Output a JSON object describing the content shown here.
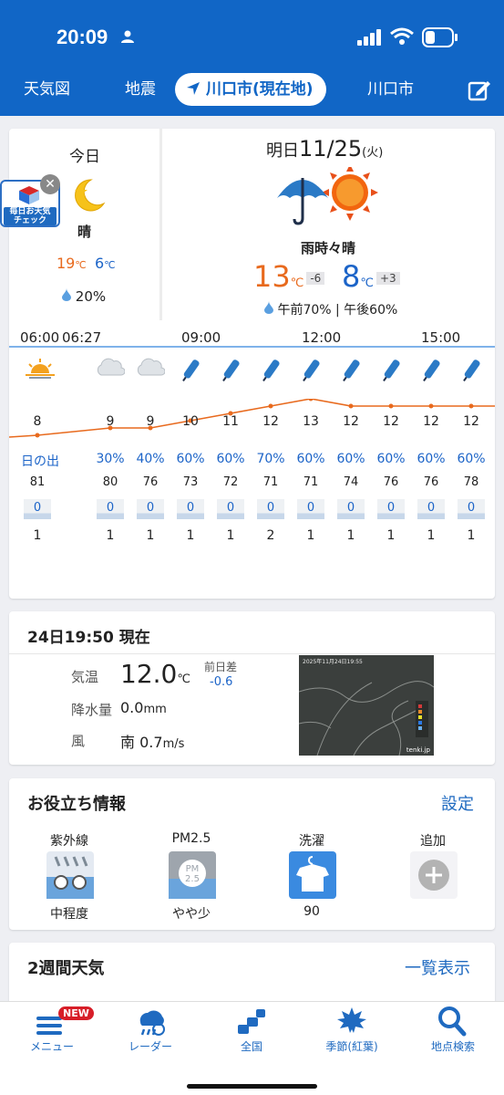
{
  "status": {
    "time": "20:09"
  },
  "tabs": [
    {
      "label": "天気図"
    },
    {
      "label": "地震"
    },
    {
      "label": "川口市(現在地)"
    },
    {
      "label": "川口市"
    }
  ],
  "badge": {
    "line1": "毎日お天気",
    "line2": "チェック"
  },
  "today": {
    "label": "今日",
    "weather": "晴",
    "hi": "19",
    "lo": "6",
    "unit": "℃",
    "rain": "20%"
  },
  "tomorrow": {
    "label_prefix": "明日",
    "date": "11/25",
    "dow": "(火)",
    "weather": "雨時々晴",
    "hi": "13",
    "hi_diff": "-6",
    "lo": "8",
    "lo_diff": "+3",
    "unit": "℃",
    "rain": "午前70% | 午後60%"
  },
  "hourly": {
    "times": [
      "06:00",
      "06:27",
      "09:00",
      "12:00",
      "15:00"
    ],
    "temps": [
      "8",
      "9",
      "9",
      "10",
      "11",
      "12",
      "13",
      "12",
      "12",
      "12",
      "12"
    ],
    "temp_values": [
      8,
      9,
      9,
      10,
      11,
      12,
      13,
      12,
      12,
      12,
      12
    ],
    "rain": [
      "30%",
      "日の出",
      "30%",
      "40%",
      "60%",
      "60%",
      "70%",
      "60%",
      "60%",
      "60%",
      "60%",
      "60%"
    ],
    "humidity": [
      "81",
      "80",
      "76",
      "73",
      "72",
      "71",
      "71",
      "74",
      "76",
      "76",
      "78"
    ],
    "precip": [
      "0",
      "0",
      "0",
      "0",
      "0",
      "0",
      "0",
      "0",
      "0",
      "0",
      "0"
    ],
    "wind": [
      "1",
      "1",
      "1",
      "1",
      "1",
      "2",
      "1",
      "1",
      "1",
      "1",
      "1"
    ],
    "icons": [
      "cloud",
      "sunrise",
      "cloud",
      "cloud",
      "umbrella",
      "umbrella",
      "umbrella",
      "umbrella",
      "umbrella",
      "umbrella",
      "umbrella",
      "umbrella"
    ]
  },
  "current": {
    "title": "24日19:50 現在",
    "temp_label": "気温",
    "temp": "12.0",
    "temp_unit": "℃",
    "diff_label": "前日差",
    "diff": "-0.6",
    "precip_label": "降水量",
    "precip": "0.0",
    "precip_unit": "mm",
    "wind_label": "風",
    "wind_dir": "南",
    "wind": "0.7",
    "wind_unit": "m/s",
    "map_caption": "2025年11月24日19:55",
    "map_credit": "tenki.jp"
  },
  "useful": {
    "title": "お役立ち情報",
    "settings": "設定",
    "items": [
      {
        "label": "紫外線",
        "value": "中程度",
        "icon": "uv-icon"
      },
      {
        "label": "PM2.5",
        "value": "やや少",
        "icon": "pm25-icon"
      },
      {
        "label": "洗濯",
        "value": "90",
        "icon": "laundry-icon"
      },
      {
        "label": "追加",
        "value": "",
        "icon": "add-icon"
      }
    ]
  },
  "weekly": {
    "title": "2週間天気",
    "link": "一覧表示"
  },
  "bottom_nav": [
    {
      "label": "メニュー",
      "badge": "NEW"
    },
    {
      "label": "レーダー"
    },
    {
      "label": "全国"
    },
    {
      "label": "季節(紅葉)"
    },
    {
      "label": "地点検索"
    }
  ],
  "colors": {
    "brand": "#1166c6",
    "hi_temp": "#e86a1e",
    "lo_temp": "#1c64c8"
  }
}
